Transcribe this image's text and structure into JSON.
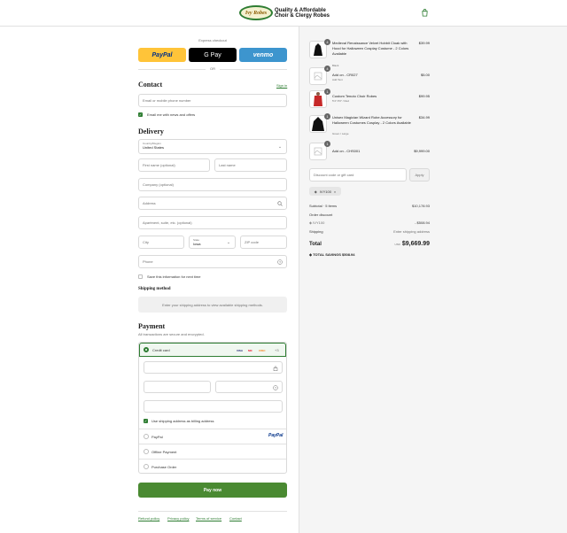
{
  "header": {
    "logo_mark": "Ivy Robes",
    "logo_line1": "Quality & Affordable",
    "logo_line2": "Choir & Clergy Robes",
    "cart_icon": "shopping-bag-icon"
  },
  "express": {
    "label": "Express checkout",
    "paypal": "PayPal",
    "gpay": "G Pay",
    "venmo": "venmo",
    "or": "OR"
  },
  "contact": {
    "title": "Contact",
    "signin": "Sign in",
    "placeholder": "Email or mobile phone number",
    "news_label": "Email me with news and offers",
    "news_checked": true
  },
  "delivery": {
    "title": "Delivery",
    "country_label": "Country/Region",
    "country_value": "United States",
    "first_name": "First name (optional)",
    "last_name": "Last name",
    "company": "Company (optional)",
    "address": "Address",
    "apartment": "Apartment, suite, etc. (optional)",
    "city": "City",
    "state_label": "State",
    "state_value": "Iowa",
    "zip": "ZIP code",
    "phone": "Phone",
    "save_label": "Save this information for next time"
  },
  "shipping": {
    "title": "Shipping method",
    "note": "Enter your shipping address to view available shipping methods."
  },
  "payment": {
    "title": "Payment",
    "subtitle": "All transactions are secure and encrypted.",
    "credit_card": "Credit card",
    "more_cards": "+3",
    "card_logos": [
      "VISA",
      "MC",
      "DISC"
    ],
    "billing_label": "Use shipping address as billing address",
    "paypal": "PayPal",
    "paypal_logo": "PayPal",
    "offline": "Offline Payment",
    "purchase_order": "Purchase Order",
    "pay_now": "Pay now"
  },
  "footer": {
    "links": [
      "Refund policy",
      "Privacy policy",
      "Terms of service",
      "Contact"
    ]
  },
  "order": {
    "items": [
      {
        "qty": "4",
        "title": "Medieval Renaissance Velvet Hobbit Cloak with Hood for Halloween Cosplay Costume - 2 Colors Available",
        "variant": "Black",
        "price": "$39.99"
      },
      {
        "qty": "4",
        "title": "Add on - CR027",
        "variant": "Add Text",
        "price": "$5.00"
      },
      {
        "qty": "1",
        "title": "Custom Tenuto Choir Robes",
        "variant": "5'4\"-5'6\" / Red",
        "price": "$99.95"
      },
      {
        "qty": "1",
        "title": "Unisex Magician Wizard Robe Accessory for Halloween Costumes Cosplay - 2 Colors Available",
        "variant": "Green / Large",
        "price": "$34.99"
      },
      {
        "qty": "1",
        "title": "Add on - CHS001",
        "variant": "",
        "price": "$9,999.00"
      }
    ],
    "discount_placeholder": "Discount code or gift card",
    "apply": "Apply",
    "applied_code": "IVY100",
    "subtotal_label": "Subtotal · 5 items",
    "subtotal_value": "$10,178.93",
    "order_discount_label": "Order discount",
    "discount_code": "IVY100",
    "discount_value": "- $508.94",
    "shipping_label": "Shipping",
    "shipping_value": "Enter shipping address",
    "total_label": "Total",
    "currency": "USD",
    "total_value": "$9,669.99",
    "savings_label": "TOTAL SAVINGS",
    "savings_value": "$508.94"
  },
  "colors": {
    "accent": "#2e7d32",
    "paynow": "#4a8a32",
    "paypal": "#ffc439",
    "venmo": "#3d95ce"
  }
}
